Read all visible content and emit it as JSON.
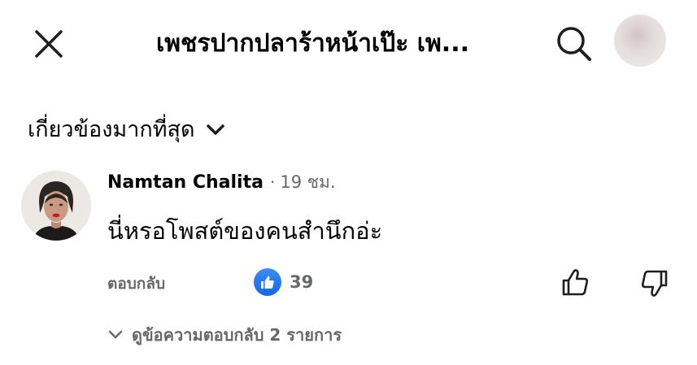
{
  "header": {
    "title": "เพชรปากปลาร้าหน้าเป๊ะ เพ...",
    "close_icon": "close-icon",
    "search_icon": "search-icon",
    "avatar": "profile-avatar"
  },
  "sort": {
    "label": "เกี่ยวข้องมากที่สุด",
    "icon": "chevron-down-icon"
  },
  "comment": {
    "author": "Namtan Chalita",
    "separator": "·",
    "time": "19 ชม.",
    "text": "นี่หรอโพสต์ของคนสำนึกอ่ะ",
    "reply_label": "ตอบกลับ",
    "like_count": "39",
    "reaction_icon": "like-reaction-icon",
    "upvote_icon": "thumbs-up-icon",
    "downvote_icon": "thumbs-down-icon",
    "view_replies_label": "ดูข้อความตอบกลับ 2 รายการ"
  },
  "colors": {
    "text_primary": "#050505",
    "text_secondary": "#65676b",
    "like_blue": "#1877f2"
  }
}
